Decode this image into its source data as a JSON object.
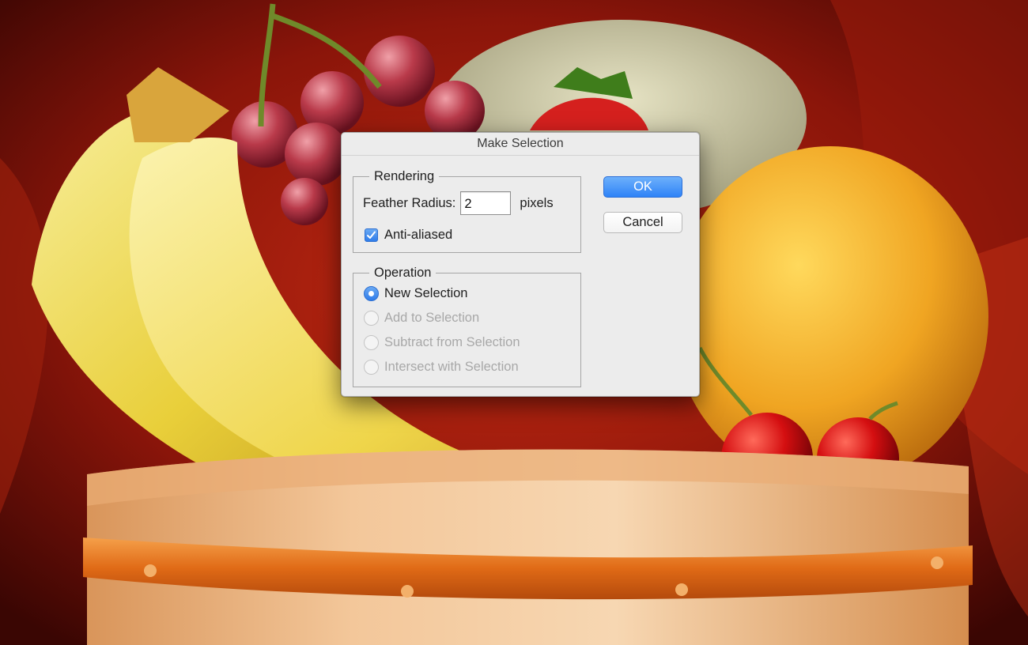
{
  "dialog": {
    "title": "Make Selection",
    "rendering": {
      "legend": "Rendering",
      "feather_label": "Feather Radius:",
      "feather_value": "2",
      "feather_unit": "pixels",
      "antialiased_label": "Anti-aliased",
      "antialiased_checked": true
    },
    "operation": {
      "legend": "Operation",
      "options": [
        {
          "label": "New Selection",
          "selected": true,
          "enabled": true
        },
        {
          "label": "Add to Selection",
          "selected": false,
          "enabled": false
        },
        {
          "label": "Subtract from Selection",
          "selected": false,
          "enabled": false
        },
        {
          "label": "Intersect with Selection",
          "selected": false,
          "enabled": false
        }
      ]
    },
    "buttons": {
      "ok_label": "OK",
      "cancel_label": "Cancel"
    }
  },
  "colors": {
    "accent": "#3b8af6",
    "dialog_bg": "#ececec",
    "disabled_text": "#a8a8a8"
  }
}
